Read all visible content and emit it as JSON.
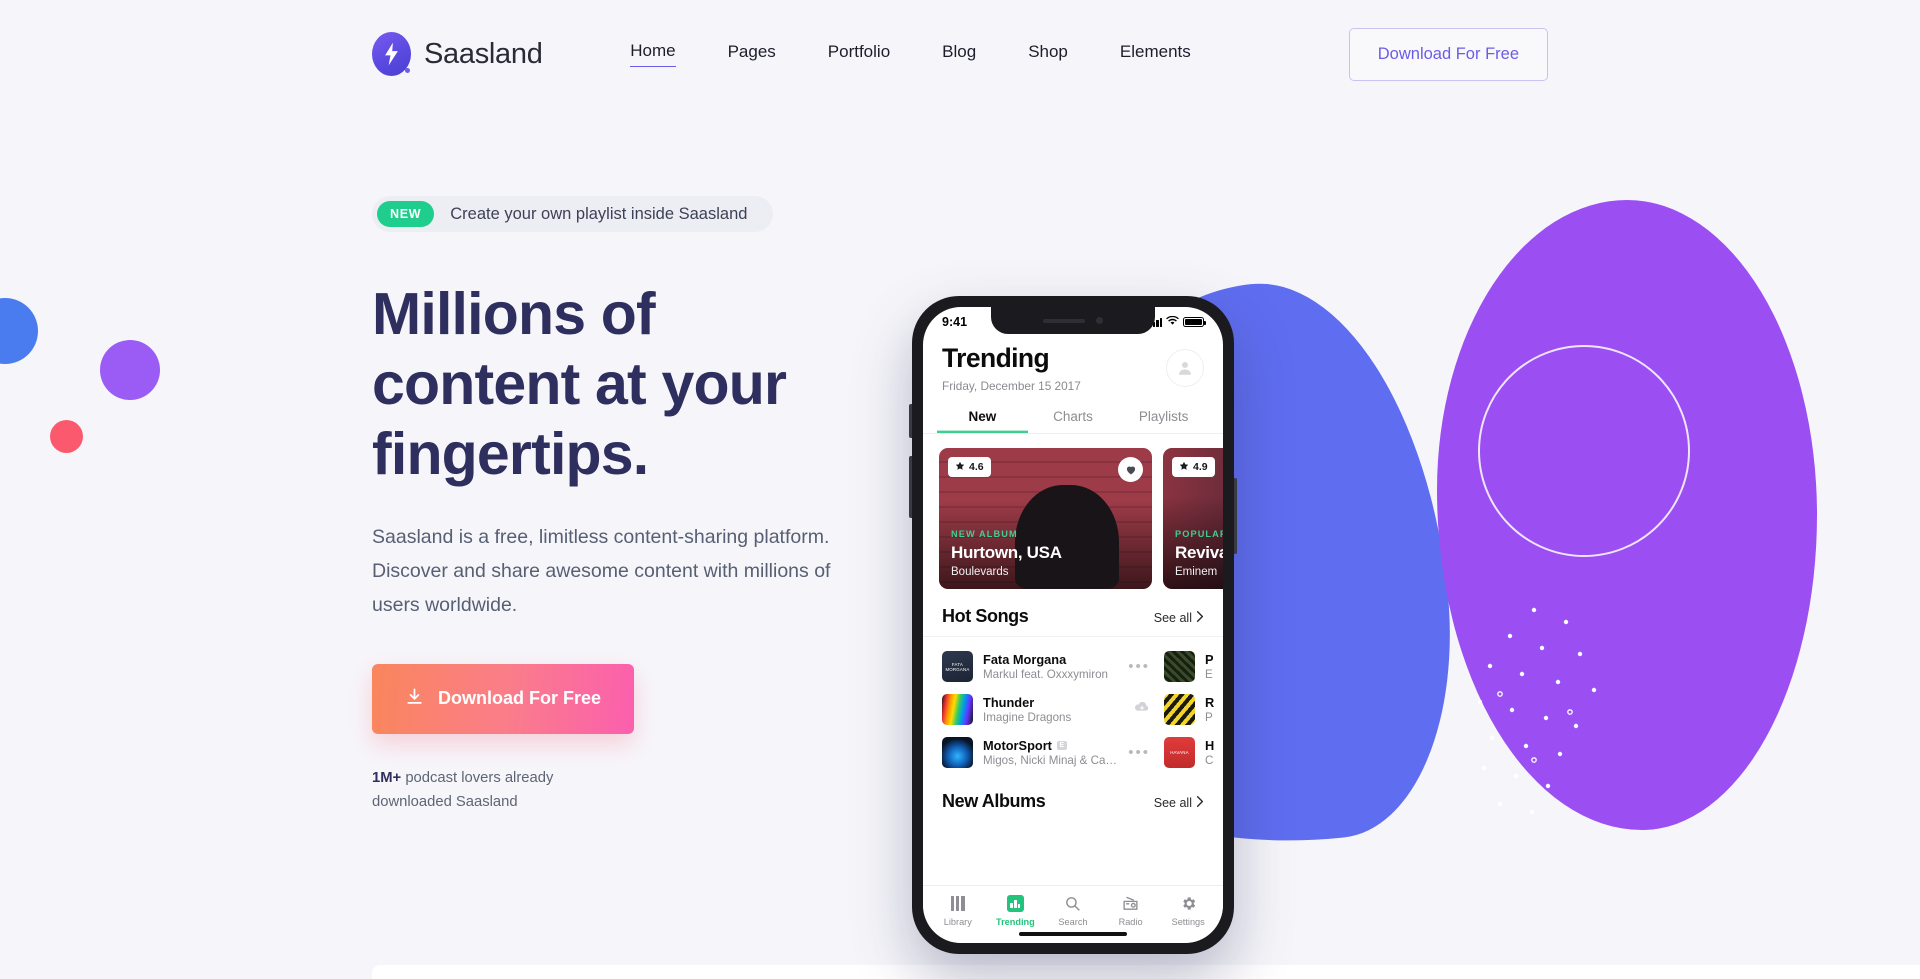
{
  "colors": {
    "page_bg": "#f6f6fa",
    "brand_purple": "#6b5ce7",
    "headline_navy": "#2e2f5e",
    "accent_green": "#1fcd8c",
    "cta_gradient_from": "#f9865c",
    "cta_gradient_to": "#fb5fae",
    "blob_blue": "#5f6ef0",
    "blob_purple": "#9b4ff3",
    "dot_blue": "#4a7cf0",
    "dot_purple": "#9b5cf6",
    "dot_pink": "#fb5a6e",
    "app_accent_green": "#21c37d"
  },
  "header": {
    "brand_name": "Saasland",
    "logo_icon": "lightning-bolt-icon",
    "nav": [
      {
        "label": "Home",
        "active": true
      },
      {
        "label": "Pages",
        "active": false
      },
      {
        "label": "Portfolio",
        "active": false
      },
      {
        "label": "Blog",
        "active": false
      },
      {
        "label": "Shop",
        "active": false
      },
      {
        "label": "Elements",
        "active": false
      }
    ],
    "cta_label": "Download For Free"
  },
  "hero": {
    "badge_label": "NEW",
    "badge_text": "Create your own playlist inside Saasland",
    "title_line1": "Millions of",
    "title_line2": "content at your",
    "title_line3": "fingertips.",
    "subtitle": "Saasland is a free, limitless content-sharing platform. Discover and share awesome content with millions of users worldwide.",
    "cta_label": "Download For Free",
    "cta_icon": "download-icon",
    "note_strong": "1M+",
    "note_rest": " podcast lovers already downloaded Saasland"
  },
  "phone": {
    "status": {
      "time": "9:41",
      "signal_icon": "cellular-signal-icon",
      "wifi_icon": "wifi-icon",
      "battery_icon": "battery-full-icon"
    },
    "app": {
      "title": "Trending",
      "date": "Friday, December 15 2017",
      "avatar_icon": "user-avatar-icon",
      "tabs": [
        {
          "label": "New",
          "active": true
        },
        {
          "label": "Charts",
          "active": false
        },
        {
          "label": "Playlists",
          "active": false
        }
      ],
      "album_cards": [
        {
          "rating": "4.6",
          "rating_icon": "star-icon",
          "heart_icon": "heart-filled-icon",
          "kicker": "NEW ALBUM",
          "title": "Hurtown, USA",
          "subtitle": "Boulevards"
        },
        {
          "rating": "4.9",
          "rating_icon": "star-icon",
          "kicker": "POPULAR",
          "title": "Revival",
          "subtitle": "Eminem"
        }
      ],
      "hot_songs": {
        "title": "Hot Songs",
        "see_all": "See all",
        "see_all_icon": "chevron-right-icon",
        "column_left": [
          {
            "name": "Fata Morgana",
            "artist": "Markul feat. Oxxxymiron",
            "action_icon": "more-dots-icon",
            "art_label": "FATA MORGANA"
          },
          {
            "name": "Thunder",
            "artist": "Imagine Dragons",
            "action_icon": "download-cloud-icon",
            "art_label": ""
          },
          {
            "name": "MotorSport",
            "explicit": "E",
            "artist": "Migos, Nicki Minaj & Cardi...",
            "action_icon": "more-dots-icon",
            "art_label": ""
          }
        ],
        "column_right": [
          {
            "name": "P",
            "artist": "E",
            "art_label": ""
          },
          {
            "name": "R",
            "artist": "P",
            "art_label": ""
          },
          {
            "name": "H",
            "artist": "C",
            "art_label": "HAVANA"
          }
        ]
      },
      "new_albums": {
        "title": "New Albums",
        "see_all": "See all",
        "see_all_icon": "chevron-right-icon"
      },
      "tab_bar": [
        {
          "label": "Library",
          "icon": "library-bars-icon",
          "active": false
        },
        {
          "label": "Trending",
          "icon": "trending-chart-icon",
          "active": true
        },
        {
          "label": "Search",
          "icon": "search-magnifier-icon",
          "active": false
        },
        {
          "label": "Radio",
          "icon": "radio-icon",
          "active": false
        },
        {
          "label": "Settings",
          "icon": "gear-icon",
          "active": false
        }
      ]
    }
  }
}
